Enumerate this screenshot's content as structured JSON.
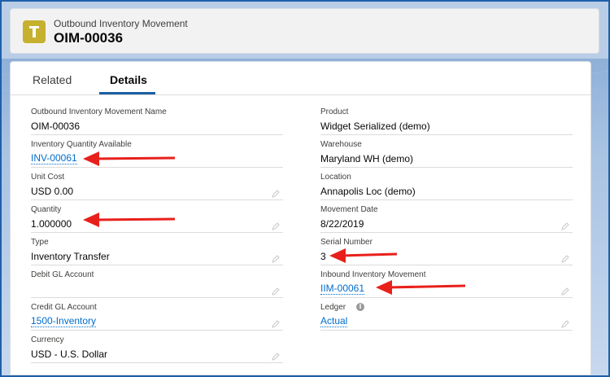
{
  "header": {
    "object_type": "Outbound Inventory Movement",
    "record_name": "OIM-00036"
  },
  "tabs": [
    {
      "label": "Related",
      "active": false
    },
    {
      "label": "Details",
      "active": true
    }
  ],
  "left_fields": [
    {
      "label": "Outbound Inventory Movement Name",
      "value": "OIM-00036",
      "link": false,
      "editable": false
    },
    {
      "label": "Inventory Quantity Available",
      "value": "INV-00061",
      "link": true,
      "editable": false
    },
    {
      "label": "Unit Cost",
      "value": "USD 0.00",
      "link": false,
      "editable": true
    },
    {
      "label": "Quantity",
      "value": "1.000000",
      "link": false,
      "editable": true
    },
    {
      "label": "Type",
      "value": "Inventory Transfer",
      "link": false,
      "editable": true
    },
    {
      "label": "Debit GL Account",
      "value": "",
      "link": false,
      "editable": true
    },
    {
      "label": "Credit GL Account",
      "value": "1500-Inventory",
      "link": true,
      "editable": true
    },
    {
      "label": "Currency",
      "value": "USD - U.S. Dollar",
      "link": false,
      "editable": true
    }
  ],
  "right_fields": [
    {
      "label": "Product",
      "value": "Widget Serialized (demo)",
      "link": false,
      "editable": false
    },
    {
      "label": "Warehouse",
      "value": "Maryland WH (demo)",
      "link": false,
      "editable": false
    },
    {
      "label": "Location",
      "value": "Annapolis Loc (demo)",
      "link": false,
      "editable": false
    },
    {
      "label": "Movement Date",
      "value": "8/22/2019",
      "link": false,
      "editable": true
    },
    {
      "label": "Serial Number",
      "value": "3",
      "link": false,
      "editable": true
    },
    {
      "label": "Inbound Inventory Movement",
      "value": "IIM-00061",
      "link": true,
      "editable": true
    },
    {
      "label": "Ledger",
      "value": "Actual",
      "link": true,
      "editable": true,
      "info_icon": true
    }
  ],
  "colors": {
    "accent": "#1b5fa5",
    "link": "#006dcc",
    "object_icon": "#c6b02f",
    "annotation_arrow": "#e8201b"
  },
  "icons": {
    "object": "inventory-t-icon",
    "edit": "pencil-icon",
    "info": "info-icon"
  }
}
